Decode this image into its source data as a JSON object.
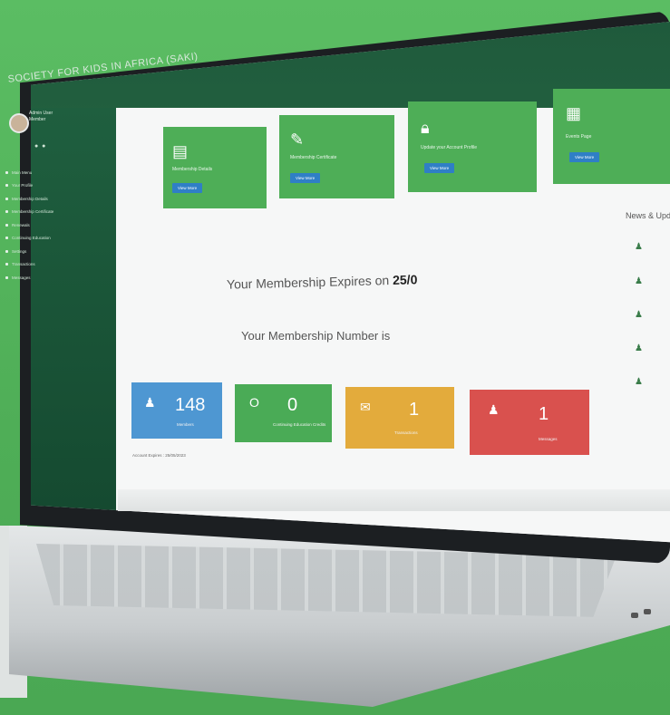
{
  "brand": "SOCIETY FOR KIDS IN AFRICA (SAKI)",
  "user": {
    "name": "Admin User",
    "role": "Member"
  },
  "sidebar_items": [
    "Main Menu",
    "Your Profile",
    "Membership Details",
    "Membership Certificate",
    "Renewals",
    "Continuing Education",
    "Settings",
    "Transactions",
    "Messages"
  ],
  "action_cards": [
    {
      "icon": "document-icon",
      "label": "Membership Details",
      "button": "View More"
    },
    {
      "icon": "clipboard-edit-icon",
      "label": "Membership Certificate",
      "button": "View More"
    },
    {
      "icon": "lock-icon",
      "label": "Update your Account Profile",
      "button": "View More"
    },
    {
      "icon": "calendar-icon",
      "label": "Events Page",
      "button": "View More"
    }
  ],
  "expires_text": "Your Membership Expires on",
  "expires_date": "25/0",
  "member_number_text": "Your Membership Number is",
  "stats": [
    {
      "icon": "user-icon",
      "value": "148",
      "label": "Members",
      "color": "#4e97d2"
    },
    {
      "icon": "zero-icon",
      "value": "0",
      "label": "Continuing Education Credits",
      "color": "#4aab56"
    },
    {
      "icon": "chat-icon",
      "value": "1",
      "label": "Transactions",
      "color": "#e3ab3c"
    },
    {
      "icon": "user-icon",
      "value": "1",
      "label": "Messages",
      "color": "#d9514e"
    }
  ],
  "right_header": "News & Updates",
  "footer_note": "Account Expires : 25/05/2023",
  "colors": {
    "background": "#52b45a",
    "sidebar": "#1c5a3b",
    "card_green": "#4eae57",
    "button_blue": "#2f7fc6"
  }
}
